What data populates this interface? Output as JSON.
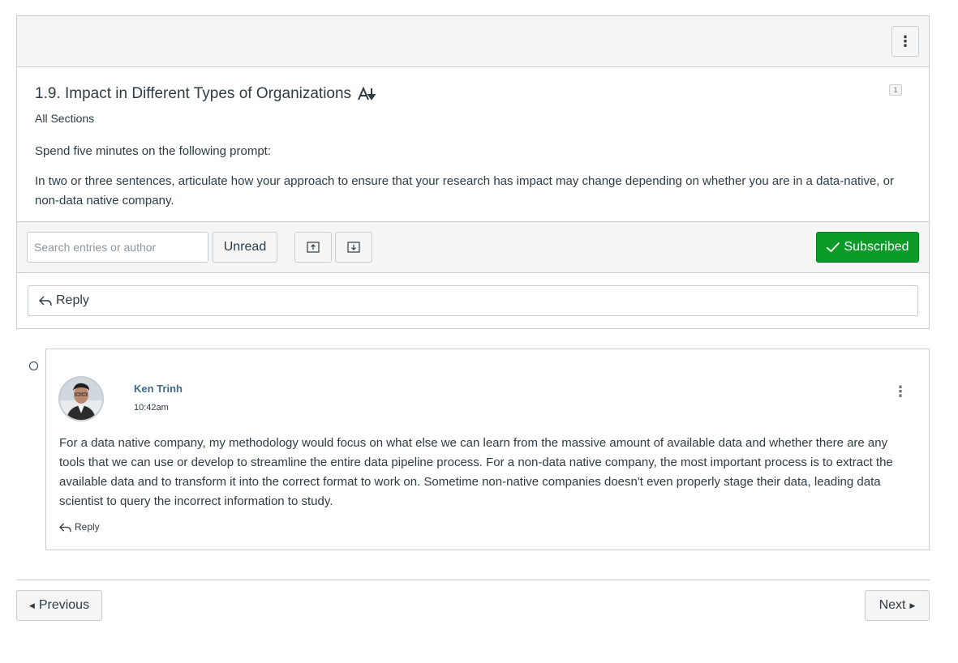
{
  "topic": {
    "title": "1.9. Impact in Different Types of Organizations",
    "sections": "All Sections",
    "count_badge": "1",
    "prompt_intro": "Spend five minutes on the following prompt:",
    "prompt_body": "In two or three sentences, articulate how your approach to ensure that your research has impact may change depending on whether you are in a data-native, or non-data native company."
  },
  "toolbar": {
    "kebab_icon": "⋮"
  },
  "filter": {
    "search_placeholder": "Search entries or author",
    "unread_label": "Unread",
    "expand_icon": "expand-all-icon",
    "collapse_icon": "collapse-all-icon",
    "subscribed_label": "Subscribed",
    "subscribed_color": "#0b9b28"
  },
  "reply_box": {
    "label": "Reply"
  },
  "entry": {
    "author": "Ken Trinh",
    "time": "10:42am",
    "message": "For a data native company, my methodology would focus on what else we can learn from the massive amount of available data and whether there are any tools that we can use or develop to streamline the entire data pipeline process. For a non-data native company, the most important process is to extract the available data and to transform it into the correct format to work on. Sometime non-native companies doesn't even properly stage their data, leading data scientist to query the incorrect information to study.",
    "reply_label": "Reply",
    "kebab_icon": "⋮"
  },
  "navigation": {
    "previous_label": "Previous",
    "next_label": "Next"
  }
}
